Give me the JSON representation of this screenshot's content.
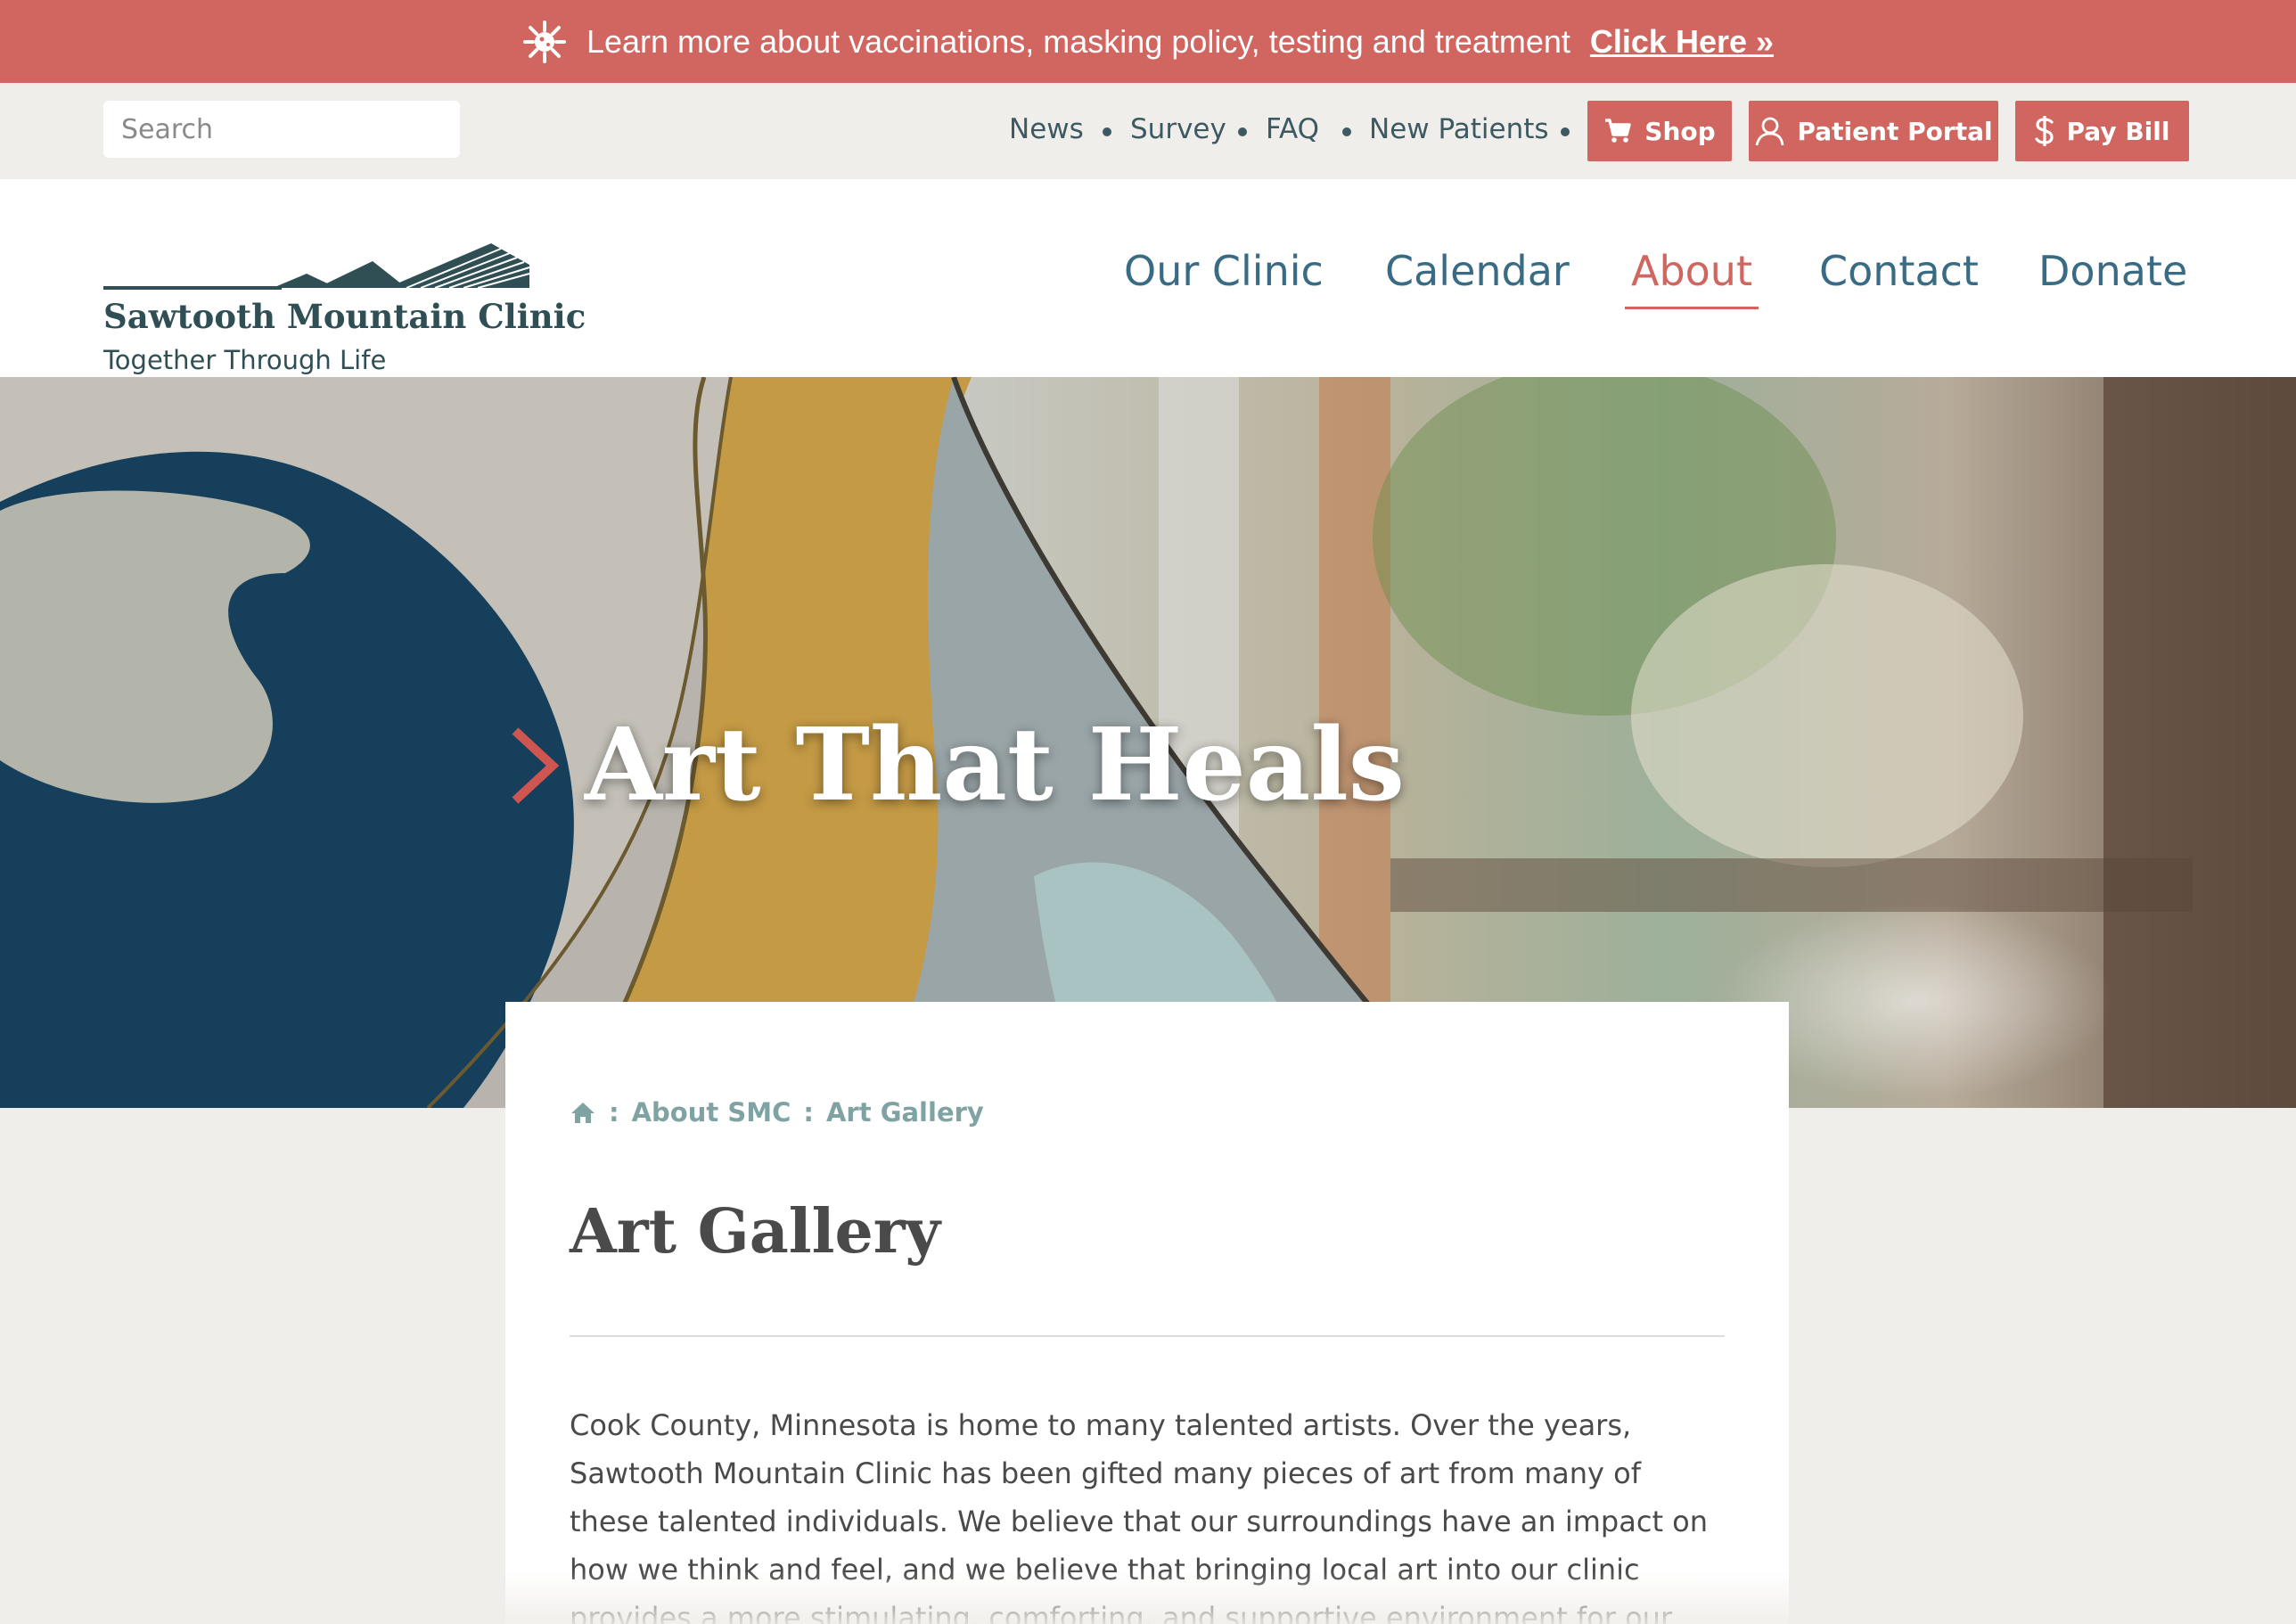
{
  "alert": {
    "text": "Learn more about vaccinations, masking policy, testing and treatment",
    "link_label": "Click Here »"
  },
  "search": {
    "placeholder": "Search"
  },
  "utility_nav": {
    "links": [
      "News",
      "Survey",
      "FAQ",
      "New Patients"
    ],
    "shop_label": "Shop",
    "portal_label": "Patient Portal",
    "pay_label": "Pay Bill"
  },
  "logo": {
    "name": "Sawtooth Mountain Clinic",
    "tagline": "Together Through Life"
  },
  "main_nav": {
    "items": [
      "Our Clinic",
      "Calendar",
      "About",
      "Contact",
      "Donate"
    ],
    "active": "About"
  },
  "hero": {
    "title": "Art That Heals"
  },
  "breadcrumb": {
    "items": [
      "About SMC",
      "Art Gallery"
    ]
  },
  "page": {
    "title": "Art Gallery",
    "intro": "Cook County, Minnesota is home to many talented artists. Over the years, Sawtooth Mountain Clinic has been gifted many pieces of art from many of these talented individuals. We believe that our surroundings have an impact on how we think and feel, and we believe that bringing local art into our clinic provides a more stimulating, comforting, and supportive environment for our"
  },
  "colors": {
    "accent": "#d0665f",
    "nav_blue": "#3a6b85",
    "logo_dark": "#2f4f55",
    "breadcrumb": "#7fa3a3"
  }
}
